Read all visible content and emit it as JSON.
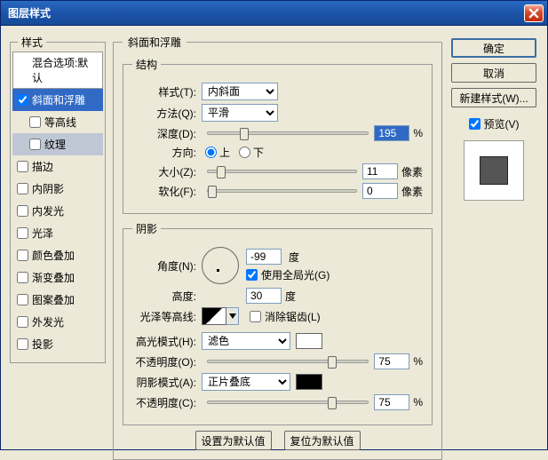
{
  "title": "图层样式",
  "sidebar": {
    "legend": "样式",
    "blendHeader": "混合选项:默认",
    "items": [
      {
        "label": "斜面和浮雕",
        "checked": true,
        "selected": true
      },
      {
        "label": "等高线",
        "checked": false,
        "sub": true
      },
      {
        "label": "纹理",
        "checked": false,
        "sub": true,
        "selSub": true
      },
      {
        "label": "描边",
        "checked": false
      },
      {
        "label": "内阴影",
        "checked": false
      },
      {
        "label": "内发光",
        "checked": false
      },
      {
        "label": "光泽",
        "checked": false
      },
      {
        "label": "颜色叠加",
        "checked": false
      },
      {
        "label": "渐变叠加",
        "checked": false
      },
      {
        "label": "图案叠加",
        "checked": false
      },
      {
        "label": "外发光",
        "checked": false
      },
      {
        "label": "投影",
        "checked": false
      }
    ]
  },
  "main": {
    "title": "斜面和浮雕",
    "structure": {
      "legend": "结构",
      "styleLabel": "样式(T):",
      "styleValue": "内斜面",
      "techLabel": "方法(Q):",
      "techValue": "平滑",
      "depthLabel": "深度(D):",
      "depthValue": "195",
      "depthUnit": "%",
      "depthPos": 20,
      "dirLabel": "方向:",
      "upLabel": "上",
      "downLabel": "下",
      "sizeLabel": "大小(Z):",
      "sizeValue": "11",
      "sizeUnit": "像素",
      "sizePos": 6,
      "softenLabel": "软化(F):",
      "softenValue": "0",
      "softenUnit": "像素",
      "softenPos": 0
    },
    "shading": {
      "legend": "阴影",
      "angleLabel": "角度(N):",
      "angleValue": "-99",
      "angleUnit": "度",
      "globalLightLabel": "使用全局光(G)",
      "globalLightChecked": true,
      "altitudeLabel": "高度:",
      "altitudeValue": "30",
      "altitudeUnit": "度",
      "glossLabel": "光泽等高线:",
      "antiAliasLabel": "消除锯齿(L)",
      "antiAliasChecked": false,
      "hlModeLabel": "高光模式(H):",
      "hlModeValue": "滤色",
      "hlColor": "#ffffff",
      "hlOpacityLabel": "不透明度(O):",
      "hlOpacityValue": "75",
      "hlOpacityUnit": "%",
      "hlOpacityPos": 75,
      "shModeLabel": "阴影模式(A):",
      "shModeValue": "正片叠底",
      "shColor": "#000000",
      "shOpacityLabel": "不透明度(C):",
      "shOpacityValue": "75",
      "shOpacityUnit": "%",
      "shOpacityPos": 75
    },
    "defaultsBtn": "设置为默认值",
    "resetBtn": "复位为默认值"
  },
  "right": {
    "ok": "确定",
    "cancel": "取消",
    "newStyle": "新建样式(W)...",
    "previewLabel": "预览(V)",
    "previewChecked": true
  }
}
